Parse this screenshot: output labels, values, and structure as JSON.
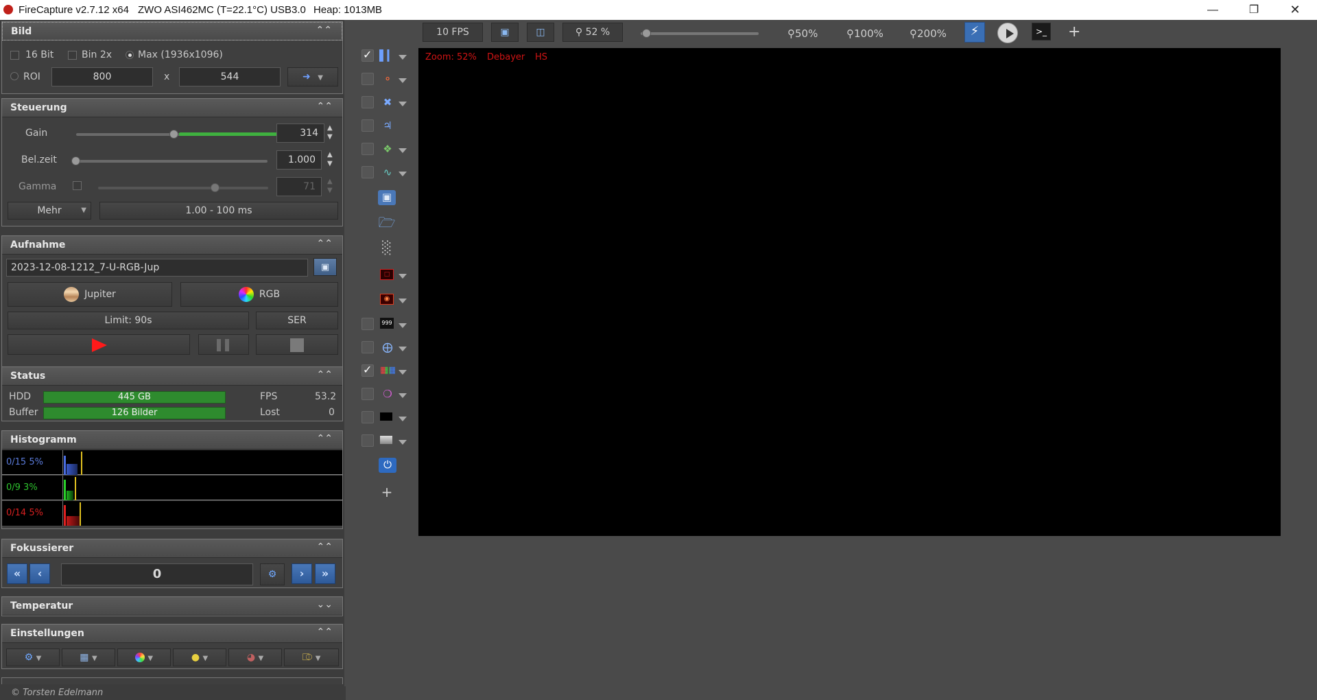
{
  "titlebar": {
    "app": "FireCapture v2.7.12 x64",
    "camera": "ZWO ASI462MC (T=22.1°C) USB3.0",
    "heap": "Heap: 1013MB"
  },
  "bild": {
    "title": "Bild",
    "opt_16bit": "16 Bit",
    "opt_bin": "Bin 2x",
    "opt_max": "Max (1936x1096)",
    "roi_label": "ROI",
    "roi_w": "800",
    "roi_x": "x",
    "roi_h": "544"
  },
  "steuerung": {
    "title": "Steuerung",
    "gain_label": "Gain",
    "gain_value": "314",
    "belzeit_label": "Bel.zeit",
    "belzeit_value": "1.000",
    "gamma_label": "Gamma",
    "gamma_value": "71",
    "mehr_label": "Mehr",
    "range_label": "1.00 - 100 ms"
  },
  "aufnahme": {
    "title": "Aufnahme",
    "filename": "2023-12-08-1212_7-U-RGB-Jup",
    "object_label": "Jupiter",
    "filter_label": "RGB",
    "limit_label": "Limit: 90s",
    "format_label": "SER"
  },
  "status": {
    "title": "Status",
    "hdd_label": "HDD",
    "hdd_value": "445 GB",
    "buffer_label": "Buffer",
    "buffer_value": "126 Bilder",
    "fps_label": "FPS",
    "fps_value": "53.2",
    "lost_label": "Lost",
    "lost_value": "0"
  },
  "histogramm": {
    "title": "Histogramm",
    "blue_label": "0/15 5%",
    "green_label": "0/9 3%",
    "red_label": "0/14 5%"
  },
  "fokussierer": {
    "title": "Fokussierer",
    "value": "0"
  },
  "temperatur": {
    "title": "Temperatur"
  },
  "einstellungen": {
    "title": "Einstellungen"
  },
  "copyright": "© Torsten Edelmann",
  "toolbar": {
    "fps": "10 FPS",
    "zoom_value": "52 %",
    "zoom_50": "50%",
    "zoom_100": "100%",
    "zoom_200": "200%",
    "plus": "+"
  },
  "preview": {
    "zoom_overlay": "Zoom: 52%",
    "debayer_overlay": "Debayer",
    "hs_overlay": "HS"
  },
  "colors": {
    "accent_blue": "#3a6fb5",
    "status_green": "#2e8b2e",
    "overlay_red": "#d11414"
  }
}
